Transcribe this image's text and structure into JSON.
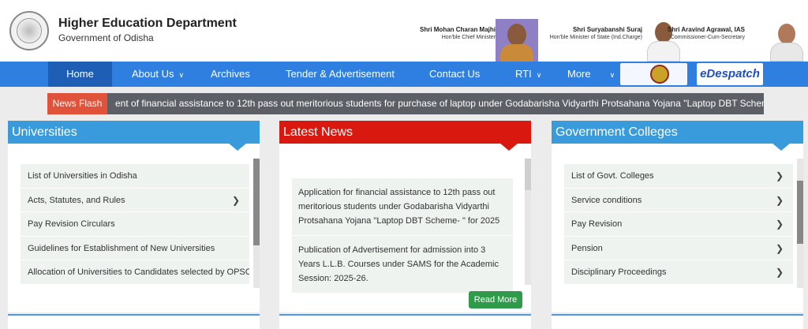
{
  "header": {
    "title": "Higher Education Department",
    "subtitle": "Government of Odisha",
    "officials": [
      {
        "name": "Shri Mohan Charan Majhi",
        "title": "Hon'ble Chief Minister"
      },
      {
        "name": "Shri Suryabanshi Suraj",
        "title": "Hon'ble Minister of State (Ind.Charge)"
      },
      {
        "name": "Shri Aravind Agrawal, IAS",
        "title": "Commissioner-Cum-Secretary"
      }
    ]
  },
  "nav": {
    "items": [
      "Home",
      "About Us",
      "Archives",
      "Tender & Advertisement",
      "Contact Us",
      "RTI",
      "More"
    ],
    "despatch_label": "eDespatch"
  },
  "news_flash": {
    "label": "News Flash",
    "text": "ent of financial assistance to 12th pass out meritorious students for purchase of laptop under Godabarisha Vidyarthi Protsahana Yojana \"Laptop DBT Scheme- \" f"
  },
  "universities": {
    "title": "Universities",
    "items": [
      "List of Universities in Odisha",
      "Acts, Statutes, and Rules",
      "Pay Revision Circulars",
      "Guidelines for Establishment of New Universities",
      "Allocation of Universities to Candidates selected by OPSC"
    ]
  },
  "latest_news": {
    "title": "Latest News",
    "items": [
      "Application for financial assistance to 12th pass out meritorious students under Godabarisha Vidyarthi Protsahana Yojana \"Laptop DBT Scheme- \" for 2025",
      "Publication of Advertisement for admission into 3 Years L.L.B. Courses under SAMS for the Academic Session: 2025-26."
    ],
    "read_more": "Read More"
  },
  "govt_colleges": {
    "title": "Government Colleges",
    "items": [
      "List of Govt. Colleges",
      "Service conditions",
      "Pay Revision",
      "Pension",
      "Disciplinary Proceedings"
    ]
  },
  "colors": {
    "nav_bg": "#2f7fe0",
    "universities_head": "#3a9bdc",
    "latest_news_head": "#d9190f",
    "colleges_head": "#3a9bdc",
    "news_flash_label": "#e0533a",
    "read_more_bg": "#2f9a4a"
  }
}
